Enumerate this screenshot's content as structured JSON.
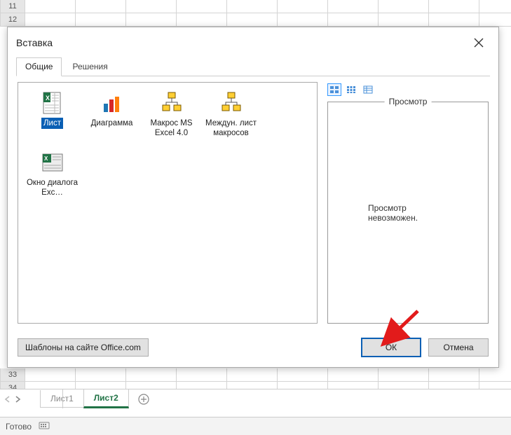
{
  "rows_visible": [
    "11",
    "12",
    "33",
    "34"
  ],
  "sheet_tabs": {
    "tab1": "Лист1",
    "tab2": "Лист2"
  },
  "status": {
    "ready": "Готово"
  },
  "dialog": {
    "title": "Вставка",
    "tabs": {
      "general": "Общие",
      "solutions": "Решения"
    },
    "items": {
      "sheet": "Лист",
      "chart": "Диаграмма",
      "macro": "Макрос MS Excel 4.0",
      "intl": "Междун. лист макросов",
      "exdlg": "Окно диалога Exc…"
    },
    "preview": {
      "label": "Просмотр",
      "msg": "Просмотр невозможен."
    },
    "buttons": {
      "templates": "Шаблоны на сайте Office.com",
      "ok": "ОК",
      "cancel": "Отмена"
    }
  }
}
